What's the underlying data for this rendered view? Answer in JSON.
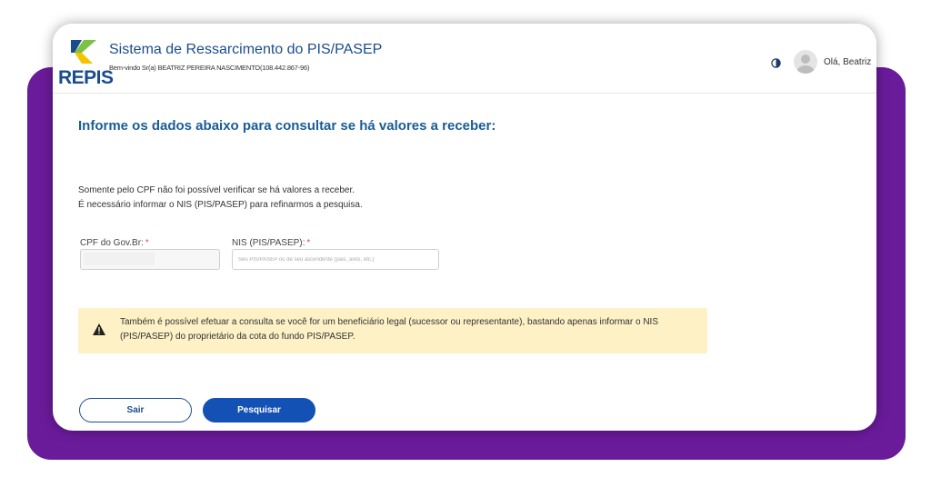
{
  "header": {
    "logo_text": "REPIS",
    "app_title": "Sistema de Ressarcimento do PIS/PASEP",
    "welcome": "Bem-vindo Sr(a) BEATRIZ PEREIRA NASCIMENTO(108.442.867-96)",
    "contrast_icon": "contrast-icon",
    "greeting": "Olá, Beatriz"
  },
  "form": {
    "heading": "Informe os dados abaixo para consultar se há valores a receber:",
    "message_line1": "Somente pelo CPF não foi possível verificar se há valores a receber.",
    "message_line2": "É necessário informar o NIS (PIS/PASEP) para refinarmos a pesquisa.",
    "cpf_label": "CPF do Gov.Br:",
    "nis_label": "NIS (PIS/PASEP):",
    "required_mark": "*",
    "cpf_value": "",
    "nis_value": "",
    "nis_placeholder": "Seu PIS/PASEP ou de seu ascendente (pais, avós, etc.)"
  },
  "alert": {
    "icon": "warning-icon",
    "text": "Também é possível efetuar a consulta se você for um beneficiário legal (sucessor ou representante), bastando apenas informar o NIS (PIS/PASEP) do proprietário da cota do fundo PIS/PASEP."
  },
  "buttons": {
    "sair": "Sair",
    "pesquisar": "Pesquisar"
  },
  "colors": {
    "frame_purple": "#6a1b9a",
    "brand_blue": "#1a4d8f",
    "primary_button": "#1351b4",
    "alert_bg": "#fdf1c5",
    "logo_green": "#7cc243",
    "logo_yellow": "#f2c500"
  }
}
